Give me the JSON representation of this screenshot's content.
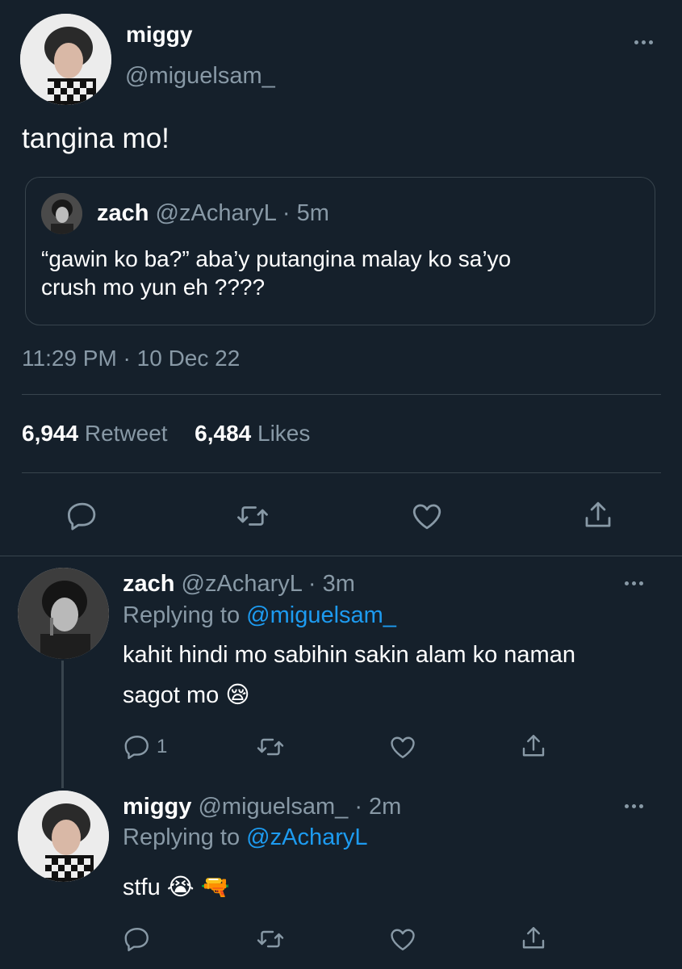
{
  "main_tweet": {
    "name": "miggy",
    "handle": "@miguelsam_",
    "text": "tangina mo!",
    "quoted": {
      "name": "zach",
      "handle": "@zAcharyL",
      "sep": "·",
      "time": "5m",
      "text_line1": "“gawin ko ba?” aba’y putangina malay ko sa’yo",
      "text_line2": "crush mo yun eh ????"
    },
    "timestamp": "11:29 PM · 10 Dec 22",
    "retweets_count": "6,944",
    "retweets_label": "Retweet",
    "likes_count": "6,484",
    "likes_label": "Likes",
    "actions": [
      "reply-icon",
      "retweet-icon",
      "like-icon",
      "share-icon"
    ]
  },
  "replies": [
    {
      "name": "zach",
      "handle": "@zAcharyL",
      "sep": "·",
      "time": "3m",
      "replying_label": "Replying to",
      "replying_to": "@miguelsam_",
      "text_line1": "kahit hindi mo sabihin sakin alam ko naman",
      "text_line2": "sagot mo 😪",
      "reply_count": "1"
    },
    {
      "name": "miggy",
      "handle": "@miguelsam_",
      "sep": "·",
      "time": "2m",
      "replying_label": "Replying to",
      "replying_to": "@zAcharyL",
      "text_line1": "stfu 😭 🔫",
      "reply_count": ""
    }
  ],
  "colors": {
    "background": "#15202b",
    "muted": "#8899a6",
    "link": "#1d9bf0",
    "divider": "#38444d"
  }
}
